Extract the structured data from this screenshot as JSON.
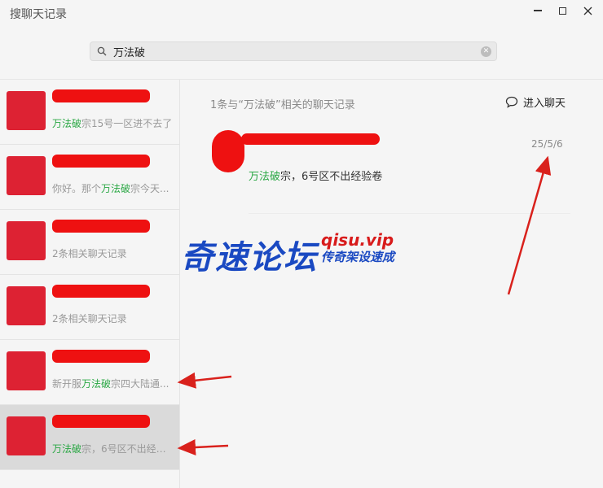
{
  "window": {
    "title": "搜聊天记录"
  },
  "search": {
    "value": "万法破",
    "placeholder": "搜索"
  },
  "conversations": [
    {
      "snippet_pre": "",
      "snippet_hl": "万法破",
      "snippet_post": "宗15号一区进不去了",
      "selected": false
    },
    {
      "snippet_pre": "你好。那个",
      "snippet_hl": "万法破",
      "snippet_post": "宗今天...",
      "selected": false
    },
    {
      "snippet_pre": "2条相关聊天记录",
      "snippet_hl": "",
      "snippet_post": "",
      "selected": false
    },
    {
      "snippet_pre": "2条相关聊天记录",
      "snippet_hl": "",
      "snippet_post": "",
      "selected": false
    },
    {
      "snippet_pre": "新开服",
      "snippet_hl": "万法破",
      "snippet_post": "宗四大陆通...",
      "selected": false
    },
    {
      "snippet_pre": "",
      "snippet_hl": "万法破",
      "snippet_post": "宗，6号区不出经验...",
      "selected": true
    }
  ],
  "detail": {
    "header": "1条与“万法破”相关的聊天记录",
    "enter_chat_label": "进入聊天",
    "message": {
      "date": "25/5/6",
      "text_hl": "万法破",
      "text_post": "宗，6号区不出经验卷"
    }
  },
  "watermark": {
    "brand": "奇速论坛",
    "url": "qisu.vip",
    "slogan": "传奇架设速成"
  },
  "colors": {
    "highlight": "#2aa744",
    "redaction": "#e11111",
    "watermark_blue": "#1a49c2",
    "watermark_red": "#d81b1b",
    "selected_row": "#dadada"
  }
}
